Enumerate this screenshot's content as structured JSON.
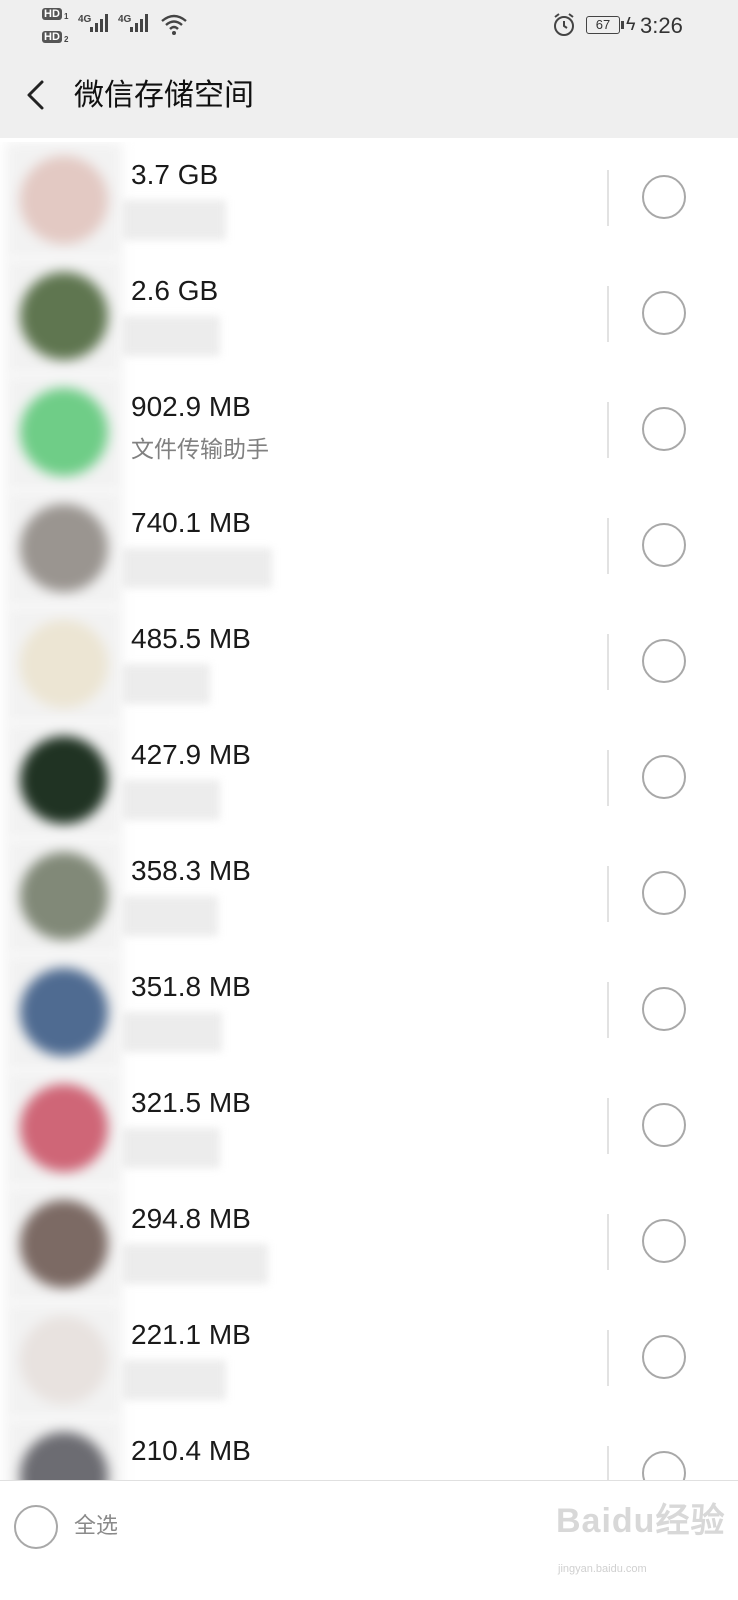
{
  "status_bar": {
    "sim1": "HD",
    "sim1_index": "1",
    "sim2": "HD",
    "sim2_index": "2",
    "network1": "4G",
    "network2": "4G",
    "battery": "67",
    "time": "3:26"
  },
  "header": {
    "title": "微信存储空间",
    "back_icon": "chevron-left-icon"
  },
  "list": {
    "items": [
      {
        "size": "3.7 GB",
        "name": "",
        "avatar_color": "#e3c9c3"
      },
      {
        "size": "2.6 GB",
        "name": "",
        "avatar_color": "#5f7650"
      },
      {
        "size": "902.9 MB",
        "name": "文件传输助手",
        "avatar_color": "#6fcd87"
      },
      {
        "size": "740.1 MB",
        "name": "",
        "avatar_color": "#9a9590"
      },
      {
        "size": "485.5 MB",
        "name": "",
        "avatar_color": "#ece5d3"
      },
      {
        "size": "427.9 MB",
        "name": "",
        "avatar_color": "#203323"
      },
      {
        "size": "358.3 MB",
        "name": "",
        "avatar_color": "#818978"
      },
      {
        "size": "351.8 MB",
        "name": "",
        "avatar_color": "#4f6b91"
      },
      {
        "size": "321.5 MB",
        "name": "",
        "avatar_color": "#cf6677"
      },
      {
        "size": "294.8 MB",
        "name": "",
        "avatar_color": "#7c6a64"
      },
      {
        "size": "221.1 MB",
        "name": "",
        "avatar_color": "#e8e2df"
      },
      {
        "size": "210.4 MB",
        "name": "",
        "avatar_color": "#6c6c72"
      }
    ]
  },
  "bottom_bar": {
    "select_all_label": "全选",
    "watermark": "Baidu经验",
    "watermark_sub": "jingyan.baidu.com"
  },
  "colors": {
    "header_bg": "#efefef",
    "radio_border": "#a8a8a8",
    "secondary_text": "#808080"
  }
}
